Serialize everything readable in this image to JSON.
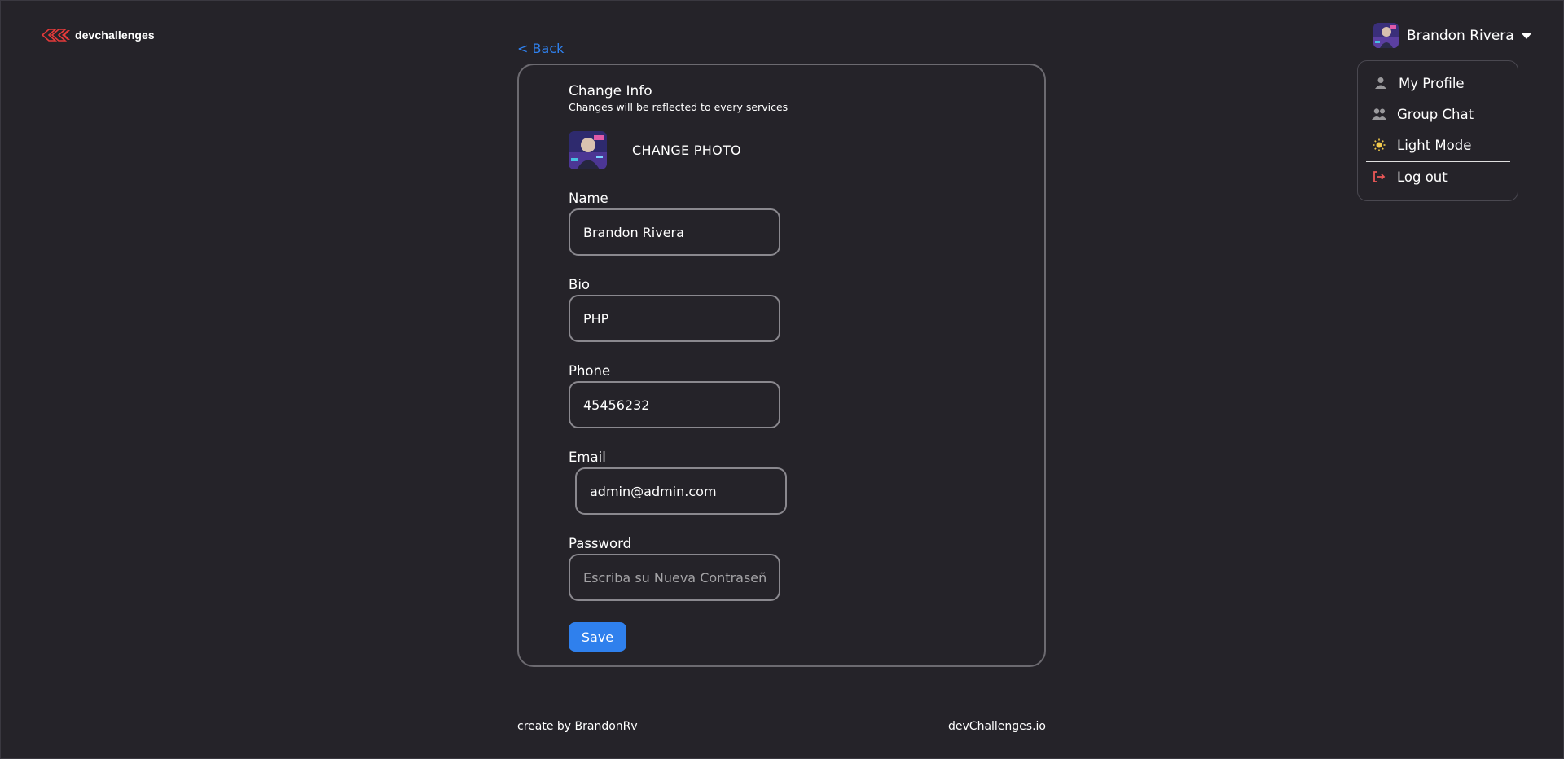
{
  "brand": {
    "logo_text": "devchallenges"
  },
  "header": {
    "user_name": "Brandon Rivera",
    "menu": [
      {
        "label": "My Profile",
        "icon": "person-icon"
      },
      {
        "label": "Group Chat",
        "icon": "group-icon"
      },
      {
        "label": "Light Mode",
        "icon": "sun-icon"
      },
      {
        "label": "Log out",
        "icon": "logout-icon"
      }
    ]
  },
  "main": {
    "back_label": "< Back",
    "title": "Change Info",
    "subtitle": "Changes will be reflected to every services",
    "change_photo_label": "CHANGE PHOTO",
    "fields": {
      "name": {
        "label": "Name",
        "value": "Brandon Rivera"
      },
      "bio": {
        "label": "Bio",
        "value": "PHP"
      },
      "phone": {
        "label": "Phone",
        "value": "45456232"
      },
      "email": {
        "label": "Email",
        "value": "admin@admin.com"
      },
      "password": {
        "label": "Password",
        "value": "",
        "placeholder": "Escriba su Nueva Contraseña"
      }
    },
    "save_label": "Save"
  },
  "footer": {
    "left": "create by BrandonRv",
    "right": "devChallenges.io"
  },
  "colors": {
    "background": "#252329",
    "accent": "#2f80ed",
    "logout": "#eb5757",
    "sun": "#f2c94c",
    "border": "#828282"
  }
}
